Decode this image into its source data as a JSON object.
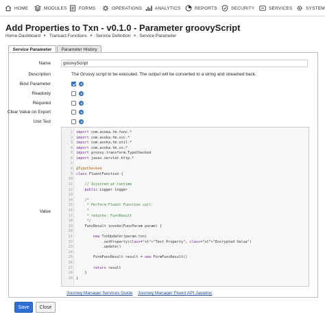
{
  "nav": {
    "items": [
      {
        "label": "HOME",
        "icon": "home-icon"
      },
      {
        "label": "MODULES",
        "icon": "modules-icon"
      },
      {
        "label": "FORMS",
        "icon": "forms-icon"
      },
      {
        "label": "OPERATIONS",
        "icon": "operations-icon"
      },
      {
        "label": "ANALYTICS",
        "icon": "analytics-icon"
      },
      {
        "label": "REPORTS",
        "icon": "reports-icon"
      },
      {
        "label": "SECURITY",
        "icon": "security-icon"
      },
      {
        "label": "SERVICES",
        "icon": "services-icon"
      },
      {
        "label": "SYSTEM",
        "icon": "system-icon"
      }
    ]
  },
  "page": {
    "title": "Add Properties to Txn - v0.1.0 - Parameter groovyScript",
    "breadcrumbs": [
      "Home Dashboard",
      "Transact Functions",
      "Service Definition",
      "Service Parameter"
    ],
    "crumb_sep": "►"
  },
  "tabs": {
    "service_parameter": "Service Parameter",
    "parameter_history": "Parameter History"
  },
  "form": {
    "name_label": "Name",
    "name_value": "groovyScript",
    "description_label": "Description",
    "description_value": "The Groovy script to be executed. The output will be converted to a string and streamed back.",
    "bind_parameter_label": "Bind Parameter",
    "readonly_label": "Readonly",
    "required_label": "Required",
    "clear_value_label": "Clear Value on Export",
    "unit_test_label": "Unit Test",
    "value_label": "Value",
    "bind_parameter_checked": true
  },
  "code": {
    "lines": [
      "import com.avoka.tm.func.*",
      "import com.avoka.tm.svc.*",
      "import com.avoka.tm.util.*",
      "import com.avoka.tm.vo.*",
      "import groovy.transform.TypeChecked",
      "import javax.servlet.http.*",
      "",
      "@TypeChecked",
      "class FluentFunction {",
      "",
      "    // Injected at runtime",
      "    public Logger logger",
      "",
      "    /*",
      "     * Perform Fluent Function call.",
      "     *",
      "     * returns: FuncResult",
      "     */",
      "    FuncResult invoke(FuncParam param) {",
      "",
      "        new TxnUpdater(param.txn)",
      "            .setProperty(\"Test Property\", \"Encrypted Value\")",
      "            .update()",
      "",
      "        FormFuncResult result = new FormFuncResult()",
      "",
      "        return result",
      "    }",
      "}"
    ]
  },
  "links": {
    "services_guide": "Journey Manager Services Guide",
    "api_javadoc": "Journey Manager Fluent API Javadoc"
  },
  "buttons": {
    "save": "Save",
    "close": "Close"
  },
  "colors": {
    "primary": "#2d6fd6",
    "link": "#1a4fa0"
  }
}
